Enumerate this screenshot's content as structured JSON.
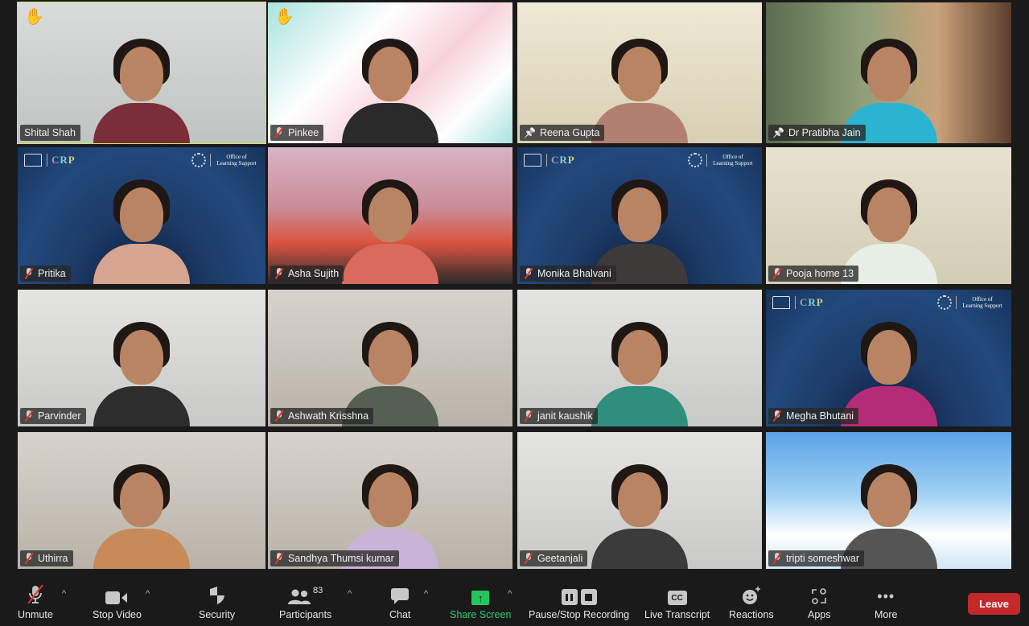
{
  "meeting": {
    "participants": [
      {
        "name": "Shital Shah",
        "muted": false,
        "pinned": false,
        "hand_raised": true,
        "active_speaker": true,
        "background": "plain"
      },
      {
        "name": "Pinkee",
        "muted": true,
        "pinned": false,
        "hand_raised": true,
        "active_speaker": false,
        "background": "pastel"
      },
      {
        "name": "Reena Gupta",
        "muted": false,
        "pinned": true,
        "hand_raised": false,
        "active_speaker": false,
        "background": "bookshelf"
      },
      {
        "name": "Dr Pratibha Jain",
        "muted": false,
        "pinned": true,
        "hand_raised": false,
        "active_speaker": false,
        "background": "library"
      },
      {
        "name": "Pritika",
        "muted": true,
        "pinned": false,
        "hand_raised": false,
        "active_speaker": false,
        "background": "crp"
      },
      {
        "name": "Asha Sujith",
        "muted": true,
        "pinned": false,
        "hand_raised": false,
        "active_speaker": false,
        "background": "room-red"
      },
      {
        "name": "Monika Bhalvani",
        "muted": true,
        "pinned": false,
        "hand_raised": false,
        "active_speaker": false,
        "background": "crp"
      },
      {
        "name": "Pooja home 13",
        "muted": true,
        "pinned": false,
        "hand_raised": false,
        "active_speaker": false,
        "background": "wall-notes"
      },
      {
        "name": "Parvinder",
        "muted": true,
        "pinned": false,
        "hand_raised": false,
        "active_speaker": false,
        "background": "wall"
      },
      {
        "name": "Ashwath Krisshna",
        "muted": true,
        "pinned": false,
        "hand_raised": false,
        "active_speaker": false,
        "background": "room"
      },
      {
        "name": "janit kaushik",
        "muted": true,
        "pinned": false,
        "hand_raised": false,
        "active_speaker": false,
        "background": "wall"
      },
      {
        "name": "Megha Bhutani",
        "muted": true,
        "pinned": false,
        "hand_raised": false,
        "active_speaker": false,
        "background": "crp"
      },
      {
        "name": "Uthirra",
        "muted": true,
        "pinned": false,
        "hand_raised": false,
        "active_speaker": false,
        "background": "room"
      },
      {
        "name": "Sandhya Thumsi kumar",
        "muted": true,
        "pinned": false,
        "hand_raised": false,
        "active_speaker": false,
        "background": "room"
      },
      {
        "name": "Geetanjali",
        "muted": true,
        "pinned": false,
        "hand_raised": false,
        "active_speaker": false,
        "background": "wall"
      },
      {
        "name": "tripti someshwar",
        "muted": true,
        "pinned": false,
        "hand_raised": false,
        "active_speaker": false,
        "background": "sky"
      }
    ],
    "crp_background": {
      "brand": "CRP",
      "office_line1": "Office of",
      "office_line2": "Learning Support"
    }
  },
  "toolbar": {
    "unmute": "Unmute",
    "stop_video": "Stop Video",
    "security": "Security",
    "participants": "Participants",
    "participants_count": "83",
    "chat": "Chat",
    "share_screen": "Share Screen",
    "pause_stop_recording": "Pause/Stop Recording",
    "live_transcript": "Live Transcript",
    "cc": "CC",
    "reactions": "Reactions",
    "apps": "Apps",
    "more": "More",
    "leave": "Leave"
  },
  "colors": {
    "active_speaker_border": "#c9e36a",
    "share_green": "#22c55e",
    "leave_red": "#c5282a",
    "muted_red": "#e5352b",
    "crp_navy": "#1d3a66"
  }
}
